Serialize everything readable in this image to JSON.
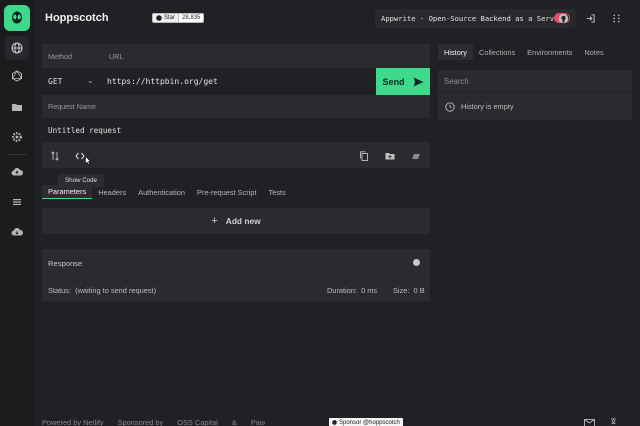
{
  "app": {
    "name": "Hoppscotch"
  },
  "github_star": {
    "label": "Star",
    "count": "28,835"
  },
  "promo": {
    "text": "Appwrite - Open-Source Backend as a Service"
  },
  "sidebar": {
    "icons": [
      "globe-icon",
      "graphql-icon",
      "folder-icon",
      "settings-icon",
      "cloud-upload-icon",
      "list-icon",
      "cloud-download-icon"
    ]
  },
  "request": {
    "method_label": "Method",
    "url_label": "URL",
    "method": "GET",
    "url": "https://httpbin.org/get",
    "send_label": "Send",
    "name_label": "Request Name",
    "name": "Untitled request",
    "tooltip": "Show Code"
  },
  "tabs": [
    "Parameters",
    "Headers",
    "Authentication",
    "Pre-request Script",
    "Tests"
  ],
  "add_new": "Add new",
  "response": {
    "title": "Response",
    "status_label": "Status:",
    "status_value": "(waiting to send request)",
    "duration_label": "Duration:",
    "duration_value": "0 ms",
    "size_label": "Size:",
    "size_value": "0 B"
  },
  "right_panel": {
    "tabs": [
      "History",
      "Collections",
      "Environments",
      "Notes"
    ],
    "search_placeholder": "Search",
    "empty_text": "History is empty"
  },
  "footer": {
    "items": [
      "Powered by Netlify",
      "Sponsored by",
      "OSS Capital",
      "&",
      "Paw"
    ],
    "sponsor_badge": "Sponsor @hoppscotch"
  },
  "colors": {
    "accent": "#3fd98b",
    "toggle": "#e64d6c"
  }
}
